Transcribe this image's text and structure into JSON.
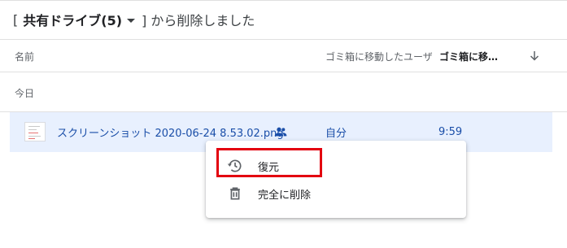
{
  "header": {
    "bracket_open": "[",
    "drive_label": "共有ドライブ(5)",
    "tail": "] から削除しました"
  },
  "columns": {
    "name": "名前",
    "deleted_by": "ゴミ箱に移動したユーザ",
    "deleted_date": "ゴミ箱に移…"
  },
  "group_label": "今日",
  "file": {
    "name": "スクリーンショット 2020-06-24 8.53.02.png",
    "owner": "自分",
    "time": "9:59",
    "shared_icon": "people-icon",
    "thumbnail_icon": "image-thumbnail-icon"
  },
  "context_menu": {
    "items": [
      {
        "label": "復元",
        "icon": "restore-history-icon"
      },
      {
        "label": "完全に削除",
        "icon": "trash-icon"
      }
    ]
  },
  "colors": {
    "selected_row": "#e8f0fe",
    "link_text": "#1a4ea8",
    "highlight_box": "#e3000f"
  }
}
